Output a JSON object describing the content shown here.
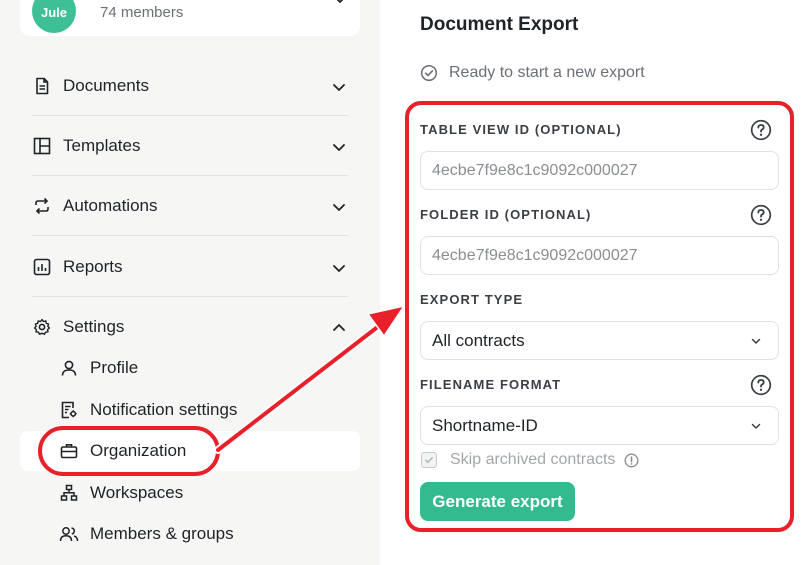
{
  "organization": {
    "avatar_text": "Jule",
    "members": "74 members"
  },
  "sidebar": {
    "items": [
      {
        "label": "Documents",
        "icon": "document-icon"
      },
      {
        "label": "Templates",
        "icon": "template-icon"
      },
      {
        "label": "Automations",
        "icon": "automations-icon"
      },
      {
        "label": "Reports",
        "icon": "reports-icon"
      },
      {
        "label": "Settings",
        "icon": "settings-icon"
      }
    ],
    "settings_subitems": [
      {
        "label": "Profile",
        "icon": "user-icon"
      },
      {
        "label": "Notification settings",
        "icon": "notification-settings-icon"
      },
      {
        "label": "Organization",
        "icon": "briefcase-icon"
      },
      {
        "label": "Workspaces",
        "icon": "workspaces-icon"
      },
      {
        "label": "Members & groups",
        "icon": "members-icon"
      }
    ],
    "active_item": "Organization"
  },
  "export": {
    "title": "Document Export",
    "status": "Ready to start a new export",
    "table_view_label": "TABLE VIEW ID (OPTIONAL)",
    "table_view_placeholder": "4ecbe7f9e8c1c9092c000027",
    "folder_label": "FOLDER ID (OPTIONAL)",
    "folder_placeholder": "4ecbe7f9e8c1c9092c000027",
    "export_type_label": "EXPORT TYPE",
    "export_type_value": "All contracts",
    "filename_format_label": "FILENAME FORMAT",
    "filename_format_value": "Shortname-ID",
    "skip_archived_label": "Skip archived contracts",
    "generate_button": "Generate export"
  },
  "colors": {
    "accent_green": "#33bb8f",
    "annotation_red": "#e8202a",
    "sidebar_bg": "#f6f6f5"
  }
}
